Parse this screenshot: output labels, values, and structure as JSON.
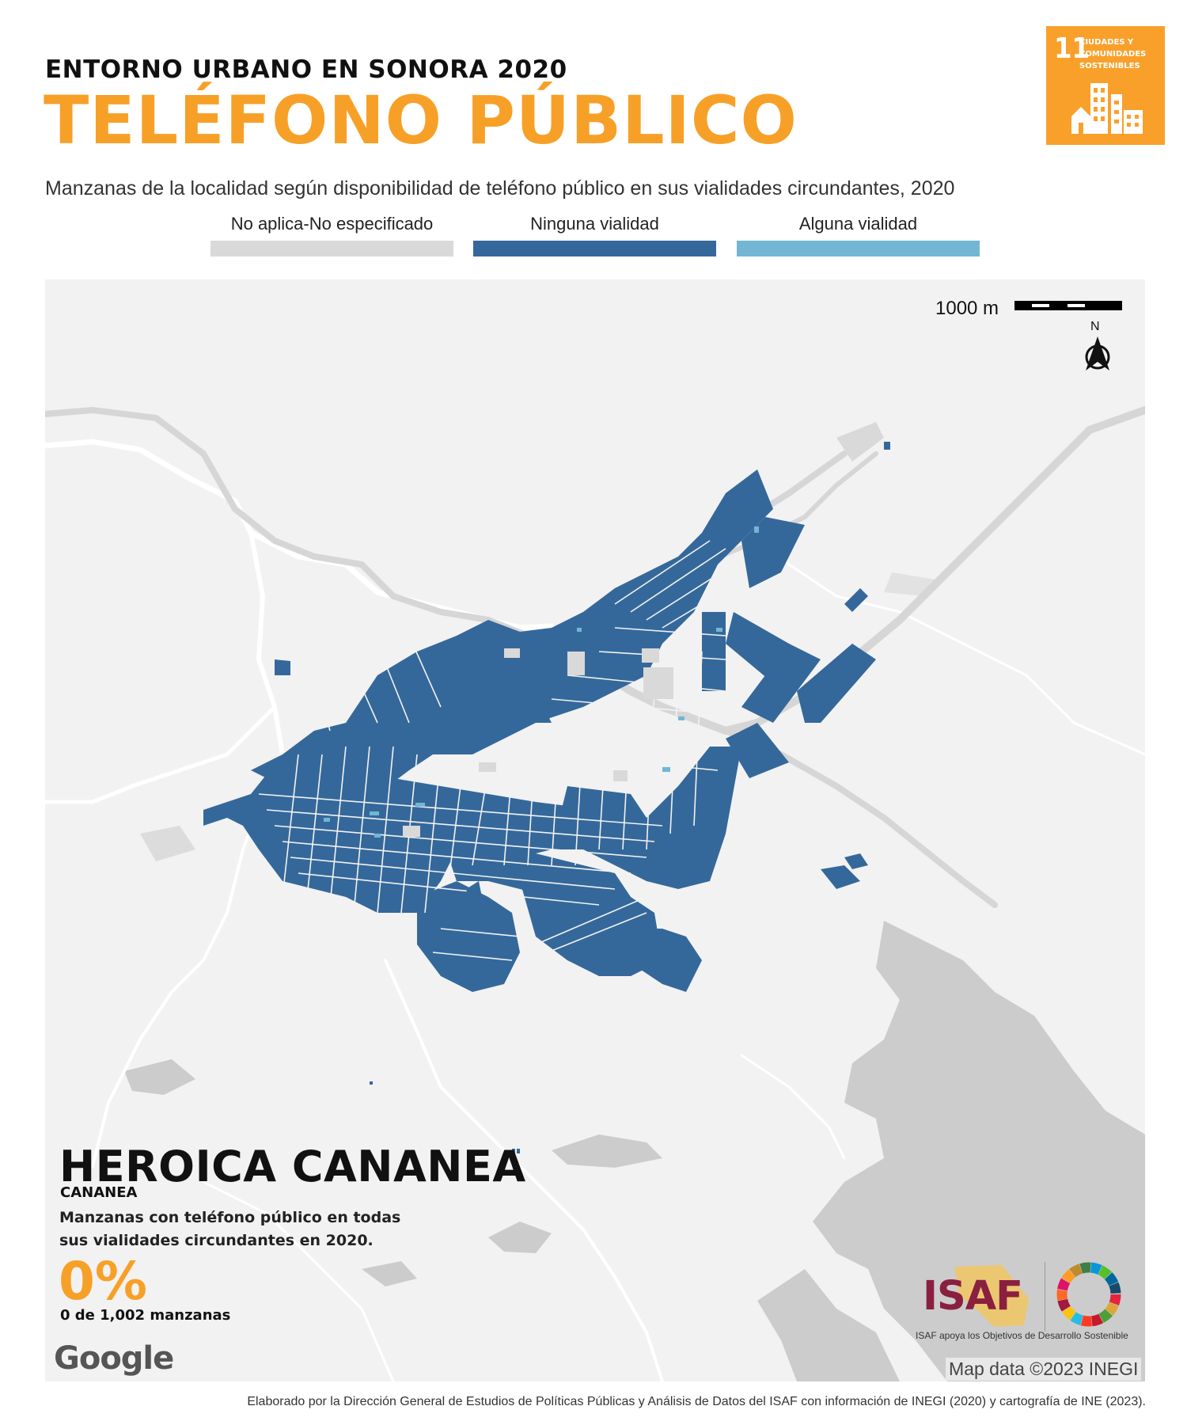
{
  "header": {
    "supertitle": "ENTORNO URBANO EN SONORA 2020",
    "title": "TELÉFONO PÚBLICO",
    "subtitle": "Manzanas de la localidad según disponibilidad de teléfono público en sus vialidades circundantes, 2020"
  },
  "sdg_badge": {
    "number": "11",
    "text_lines": [
      "CIUDADES Y",
      "COMUNIDADES",
      "SOSTENIBLES"
    ],
    "color": "#f9a02b",
    "icon": "city-buildings-icon"
  },
  "legend": [
    {
      "label": "No aplica-No especificado",
      "color": "#d9d9d9"
    },
    {
      "label": "Ninguna vialidad",
      "color": "#35689a"
    },
    {
      "label": "Alguna vialidad",
      "color": "#72b6d3"
    }
  ],
  "map": {
    "scale_label": "1000 m",
    "north_label": "N",
    "place_name": "HEROICA CANANEA",
    "municipality": "CANANEA",
    "stat_description": "Manzanas con teléfono público en todas sus vialidades circundantes en 2020.",
    "stat_value": "0%",
    "stat_count": "0 de 1,002 manzanas",
    "attribution": "Map data ©2023 INEGI",
    "google_logo": "Google",
    "colors": {
      "background": "#f2f2f2",
      "terrain": "#cccccc",
      "roads": "#ffffff",
      "highway": "#d6d6d6",
      "no_aplica": "#d9d9d9",
      "ninguna": "#35689a",
      "alguna": "#72b6d3"
    }
  },
  "logos": {
    "isaf_word": "ISAF",
    "isaf_tagline": "ISAF apoya los Objetivos de Desarrollo Sostenible",
    "sdg_wheel_icon": "sdg-wheel-icon"
  },
  "footer": {
    "credit": "Elaborado por la Dirección General de Estudios de Políticas Públicas y Análisis de Datos del ISAF con información de INEGI (2020) y cartografía de INE (2023)."
  }
}
